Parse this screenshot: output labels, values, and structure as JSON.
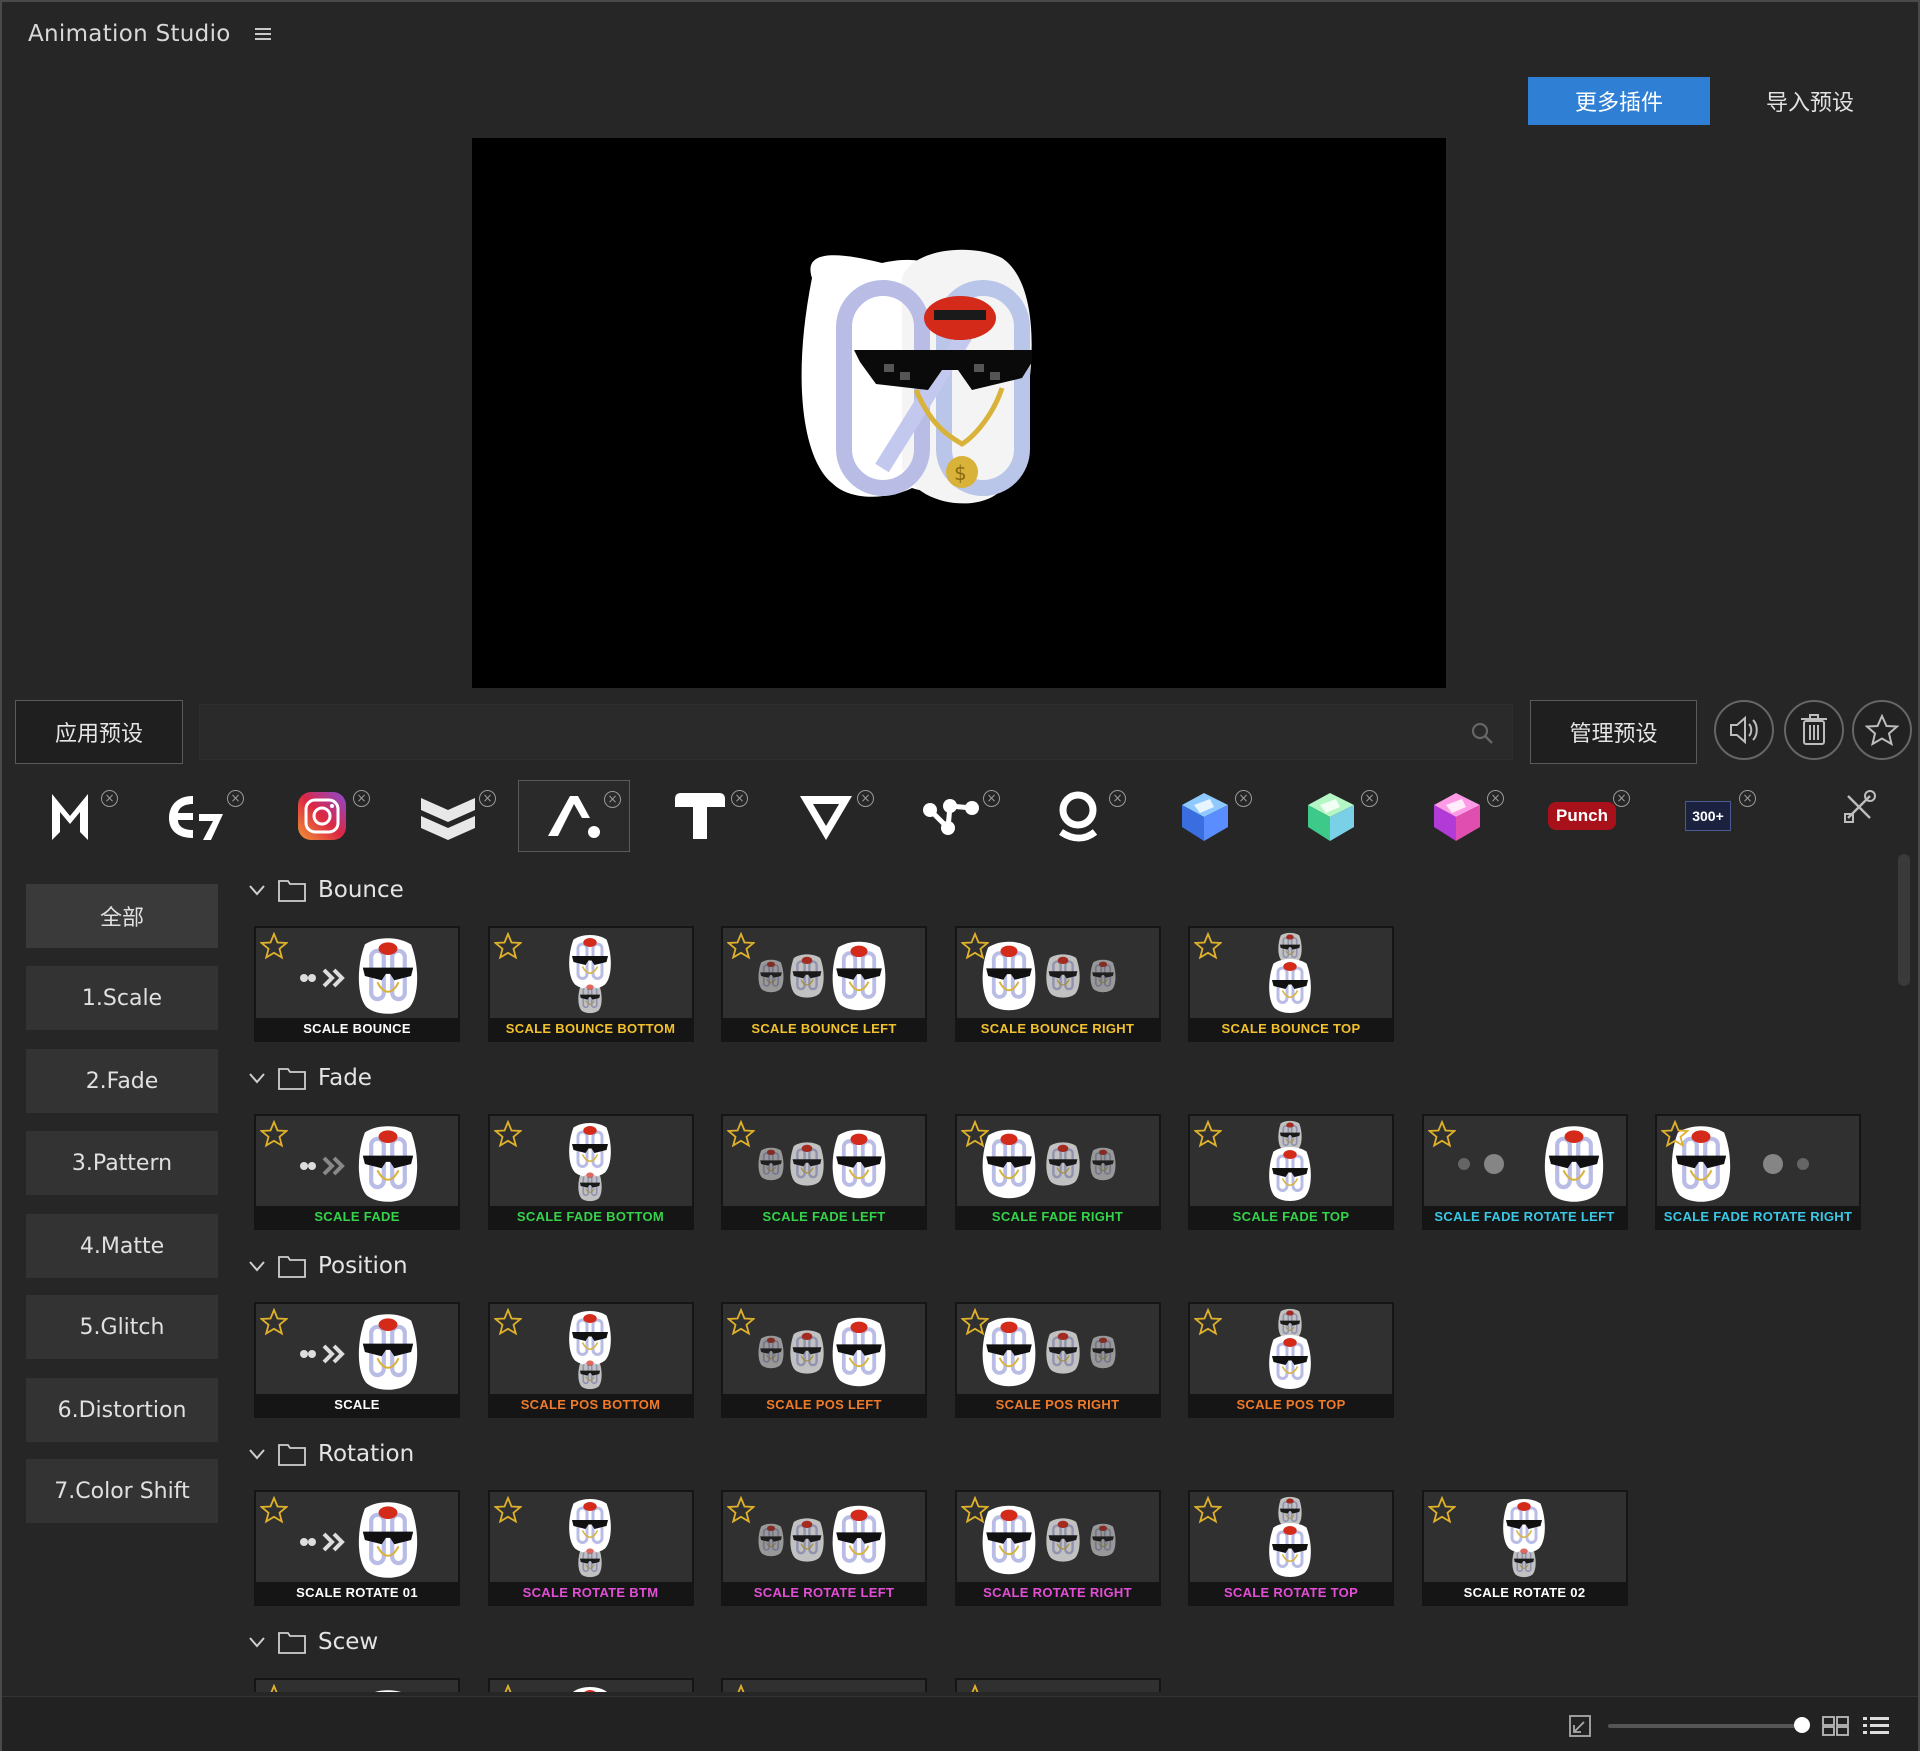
{
  "header": {
    "title": "Animation Studio",
    "more_plugins": "更多插件",
    "import_presets": "导入预设"
  },
  "toolbar": {
    "apply": "应用预设",
    "manage": "管理预设",
    "search_placeholder": ""
  },
  "plugins": [
    {
      "name": "plugin-m"
    },
    {
      "name": "plugin-e7"
    },
    {
      "name": "plugin-camera"
    },
    {
      "name": "plugin-chevrons"
    },
    {
      "name": "plugin-a-active"
    },
    {
      "name": "plugin-t"
    },
    {
      "name": "plugin-v"
    },
    {
      "name": "plugin-dots"
    },
    {
      "name": "plugin-o"
    },
    {
      "name": "plugin-cube-blue"
    },
    {
      "name": "plugin-cube-green"
    },
    {
      "name": "plugin-cube-pink"
    },
    {
      "name": "plugin-punch",
      "text": "Punch"
    },
    {
      "name": "plugin-300",
      "text": "300+"
    }
  ],
  "sidebar": [
    {
      "label": "全部"
    },
    {
      "label": "1.Scale"
    },
    {
      "label": "2.Fade"
    },
    {
      "label": "3.Pattern"
    },
    {
      "label": "4.Matte"
    },
    {
      "label": "5.Glitch"
    },
    {
      "label": "6.Distortion"
    },
    {
      "label": "7.Color Shift"
    }
  ],
  "colors": {
    "white": "#ffffff",
    "yellow": "#f2c12e",
    "green": "#34d34a",
    "cyan": "#3bc7e6",
    "orange": "#f07a2a",
    "pink": "#e24fd6",
    "accent": "#2f7fd4"
  },
  "groups": [
    {
      "name": "Bounce",
      "items": [
        {
          "label": "SCALE BOUNCE",
          "color": "white"
        },
        {
          "label": "SCALE BOUNCE BOTTOM",
          "color": "yellow"
        },
        {
          "label": "SCALE BOUNCE LEFT",
          "color": "yellow"
        },
        {
          "label": "SCALE BOUNCE RIGHT",
          "color": "yellow"
        },
        {
          "label": "SCALE BOUNCE TOP",
          "color": "yellow"
        }
      ]
    },
    {
      "name": "Fade",
      "items": [
        {
          "label": "SCALE FADE",
          "color": "green"
        },
        {
          "label": "SCALE FADE BOTTOM",
          "color": "green"
        },
        {
          "label": "SCALE FADE LEFT",
          "color": "green"
        },
        {
          "label": "SCALE FADE RIGHT",
          "color": "green"
        },
        {
          "label": "SCALE FADE TOP",
          "color": "green"
        },
        {
          "label": "SCALE FADE ROTATE LEFT",
          "color": "cyan"
        },
        {
          "label": "SCALE FADE ROTATE RIGHT",
          "color": "cyan"
        }
      ]
    },
    {
      "name": "Position",
      "items": [
        {
          "label": "SCALE",
          "color": "white"
        },
        {
          "label": "SCALE POS BOTTOM",
          "color": "orange"
        },
        {
          "label": "SCALE POS LEFT",
          "color": "orange"
        },
        {
          "label": "SCALE POS RIGHT",
          "color": "orange"
        },
        {
          "label": "SCALE POS TOP",
          "color": "orange"
        }
      ]
    },
    {
      "name": "Rotation",
      "items": [
        {
          "label": "SCALE ROTATE 01",
          "color": "white"
        },
        {
          "label": "SCALE ROTATE BTM",
          "color": "pink"
        },
        {
          "label": "SCALE ROTATE LEFT",
          "color": "pink"
        },
        {
          "label": "SCALE ROTATE RIGHT",
          "color": "pink"
        },
        {
          "label": "SCALE ROTATE TOP",
          "color": "pink"
        },
        {
          "label": "SCALE ROTATE 02",
          "color": "white"
        }
      ]
    },
    {
      "name": "Scew",
      "items": [
        {
          "label": "",
          "color": "white"
        },
        {
          "label": "",
          "color": "white"
        },
        {
          "label": "",
          "color": "white"
        },
        {
          "label": "",
          "color": "white"
        }
      ]
    }
  ]
}
